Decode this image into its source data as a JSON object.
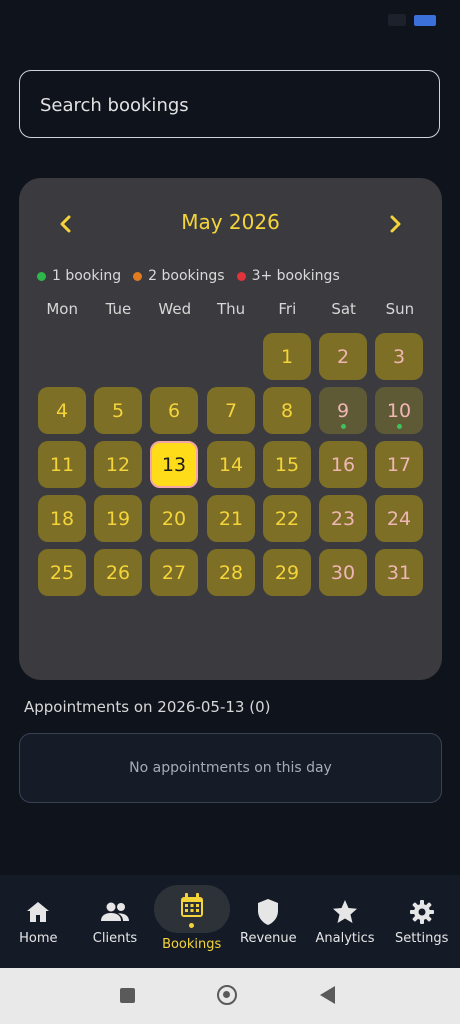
{
  "status_bar": {
    "time": "",
    "battery_color": "#3b6fd9"
  },
  "search": {
    "placeholder": "Search bookings",
    "value": ""
  },
  "calendar": {
    "prev_icon": "chevron-left-icon",
    "next_icon": "chevron-right-icon",
    "month_title": "May 2026",
    "legend": [
      {
        "label": "1 booking",
        "color": "#2db84c"
      },
      {
        "label": "2 bookings",
        "color": "#e07b20"
      },
      {
        "label": "3+ bookings",
        "color": "#e0343a"
      }
    ],
    "weekdays": [
      "Mon",
      "Tue",
      "Wed",
      "Thu",
      "Fri",
      "Sat",
      "Sun"
    ],
    "first_weekday_index": 4,
    "days": [
      "1",
      "2",
      "3",
      "4",
      "5",
      "6",
      "7",
      "8",
      "9",
      "10",
      "11",
      "12",
      "13",
      "14",
      "15",
      "16",
      "17",
      "18",
      "19",
      "20",
      "21",
      "22",
      "23",
      "24",
      "25",
      "26",
      "27",
      "28",
      "29",
      "30",
      "31"
    ],
    "booked_days": [
      9,
      10
    ],
    "selected_day": 13,
    "accent_color": "#f5d43a"
  },
  "appointments": {
    "title": "Appointments on 2026-05-13 (0)",
    "empty_text": "No appointments on this day"
  },
  "bottom_nav": {
    "items": [
      {
        "label": "Home",
        "icon": "home-icon"
      },
      {
        "label": "Clients",
        "icon": "people-icon"
      },
      {
        "label": "Bookings",
        "icon": "calendar-icon",
        "active": true
      },
      {
        "label": "Revenue",
        "icon": "shield-icon"
      },
      {
        "label": "Analytics",
        "icon": "star-icon"
      },
      {
        "label": "Settings",
        "icon": "gear-icon"
      }
    ]
  }
}
